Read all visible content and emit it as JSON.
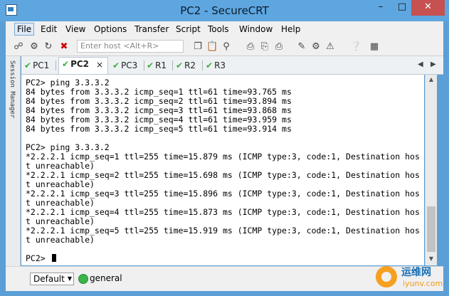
{
  "window": {
    "title": "PC2 - SecureCRT"
  },
  "menu": [
    "File",
    "Edit",
    "View",
    "Options",
    "Transfer",
    "Script",
    "Tools",
    "Window",
    "Help"
  ],
  "toolbar": {
    "host_placeholder": "Enter host <Alt+R>"
  },
  "session_panel": {
    "label": "Session Manager"
  },
  "tabs": [
    {
      "label": "PC1",
      "status": "connected"
    },
    {
      "label": "PC2",
      "status": "connected",
      "active": true
    },
    {
      "label": "PC3",
      "status": "connected"
    },
    {
      "label": "R1",
      "status": "connected"
    },
    {
      "label": "R2",
      "status": "connected"
    },
    {
      "label": "R3",
      "status": "connected"
    }
  ],
  "tab_controls": {
    "close": "×",
    "prev": "◀",
    "next": "▶"
  },
  "terminal": {
    "lines": [
      "PC2> ping 3.3.3.2",
      "84 bytes from 3.3.3.2 icmp_seq=1 ttl=61 time=93.765 ms",
      "84 bytes from 3.3.3.2 icmp_seq=2 ttl=61 time=93.894 ms",
      "84 bytes from 3.3.3.2 icmp_seq=3 ttl=61 time=93.868 ms",
      "84 bytes from 3.3.3.2 icmp_seq=4 ttl=61 time=93.959 ms",
      "84 bytes from 3.3.3.2 icmp_seq=5 ttl=61 time=93.914 ms",
      "",
      "PC2> ping 3.3.3.2",
      "*2.2.2.1 icmp_seq=1 ttl=255 time=15.879 ms (ICMP type:3, code:1, Destination hos",
      "t unreachable)",
      "*2.2.2.1 icmp_seq=2 ttl=255 time=15.698 ms (ICMP type:3, code:1, Destination hos",
      "t unreachable)",
      "*2.2.2.1 icmp_seq=3 ttl=255 time=15.896 ms (ICMP type:3, code:1, Destination hos",
      "t unreachable)",
      "*2.2.2.1 icmp_seq=4 ttl=255 time=15.873 ms (ICMP type:3, code:1, Destination hos",
      "t unreachable)",
      "*2.2.2.1 icmp_seq=5 ttl=255 time=15.919 ms (ICMP type:3, code:1, Destination hos",
      "t unreachable)",
      "",
      "PC2> "
    ]
  },
  "status": {
    "session": "Default",
    "connection": "general"
  },
  "watermark": {
    "line1": "运维网",
    "line2": "iyunv.com"
  }
}
